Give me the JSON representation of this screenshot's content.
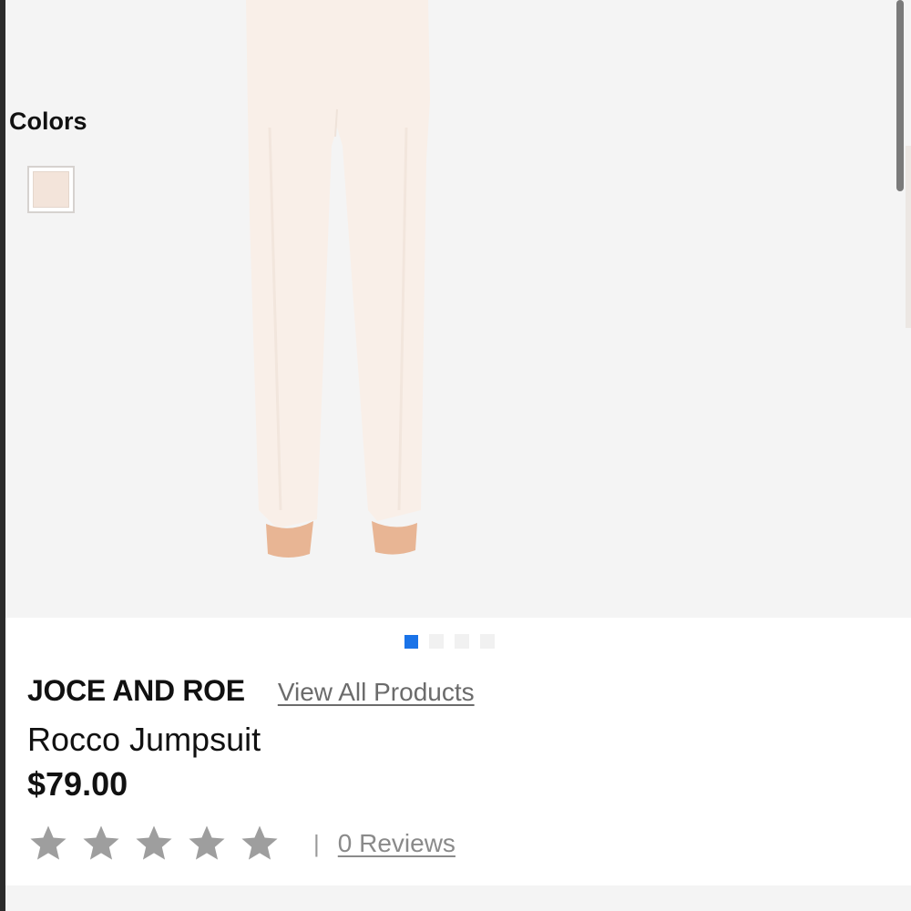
{
  "colors_label": "Colors",
  "swatches": [
    {
      "name": "cream",
      "color": "#f3e4da"
    }
  ],
  "gallery": {
    "image_alt": "pants",
    "dot_count": 4,
    "active_index": 0,
    "active_color": "#1a73e8"
  },
  "product": {
    "brand": "JOCE AND ROE",
    "view_all_label": "View All Products",
    "name": "Rocco Jumpsuit",
    "price": "$79.00"
  },
  "rating": {
    "stars": 0,
    "max_stars": 5,
    "star_color": "#9e9e9e",
    "separator": "|",
    "reviews_label": "0 Reviews"
  }
}
